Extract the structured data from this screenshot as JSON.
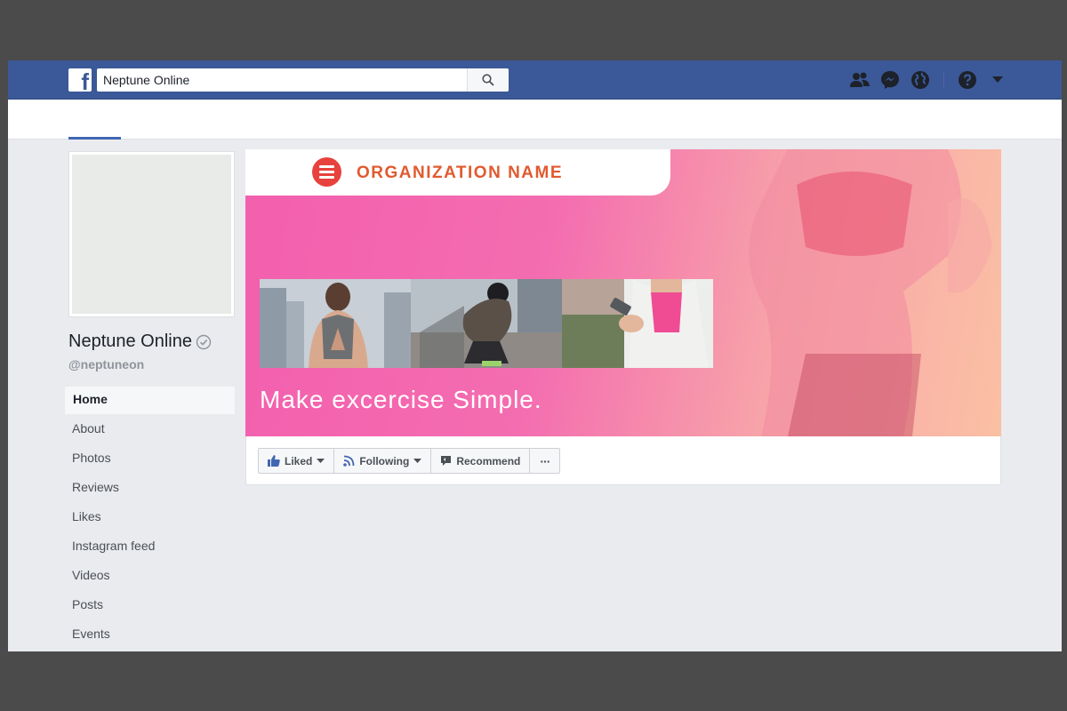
{
  "topbar": {
    "logo_letter": "f",
    "search": {
      "value": "Neptune Online",
      "placeholder": "Search"
    },
    "icons": [
      "friends-icon",
      "messenger-icon",
      "globe-icon",
      "help-icon",
      "caret-down-icon"
    ]
  },
  "page": {
    "name": "Neptune Online",
    "handle": "@neptuneon"
  },
  "left_nav": [
    {
      "label": "Home",
      "active": true
    },
    {
      "label": "About"
    },
    {
      "label": "Photos"
    },
    {
      "label": "Reviews"
    },
    {
      "label": "Likes"
    },
    {
      "label": "Instagram feed"
    },
    {
      "label": "Videos"
    },
    {
      "label": "Posts"
    },
    {
      "label": "Events"
    }
  ],
  "cover": {
    "org_name": "ORGANIZATION NAME",
    "tagline": "Make excercise Simple."
  },
  "actions": {
    "liked": "Liked",
    "following": "Following",
    "recommend": "Recommend",
    "more": "···"
  },
  "colors": {
    "brand_blue": "#3b5998",
    "cover_pink": "#f35fae",
    "cover_peach": "#fbc0a4",
    "org_orange": "#e15a2f"
  }
}
